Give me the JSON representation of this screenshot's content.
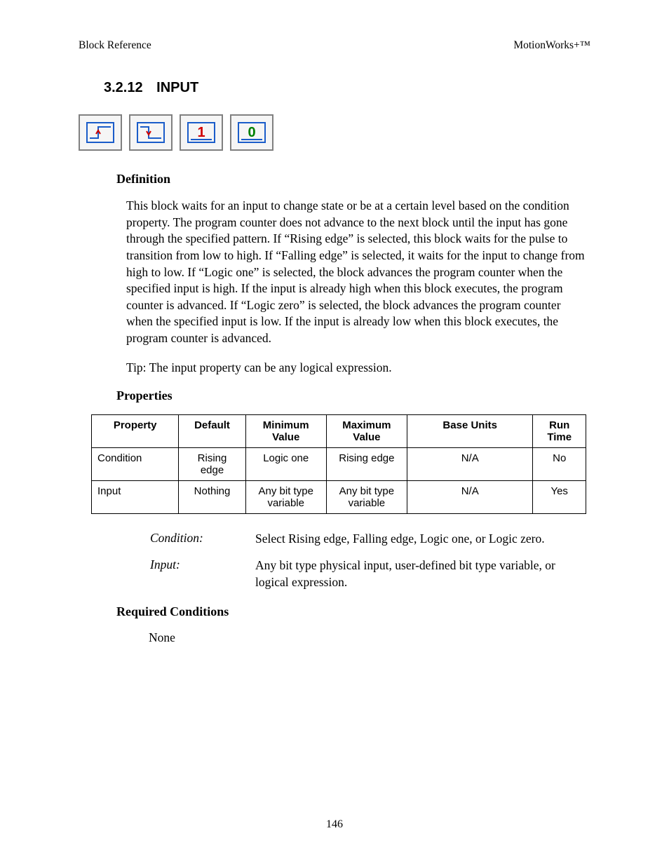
{
  "header": {
    "left": "Block Reference",
    "right": "MotionWorks+™"
  },
  "section": {
    "number": "3.2.12",
    "title": "INPUT"
  },
  "icons": [
    "rising-edge",
    "falling-edge",
    "logic-one",
    "logic-zero"
  ],
  "definition": {
    "heading": "Definition",
    "para": "This block waits for an input to change state or be at a certain level based on the condition property. The program counter does not advance to the next block until the input has gone through the specified pattern. If “Rising edge” is selected, this block waits for the pulse to transition from low to high. If “Falling edge” is selected, it waits for the input to change from high to low. If “Logic one” is selected, the block advances the program counter when the specified input is high. If the input is already high when this block executes, the program counter is advanced. If “Logic zero” is selected, the block advances the program counter when the specified input is low. If the input is already low when this block executes, the program counter is advanced.",
    "tip": "Tip:  The input property can be any logical expression."
  },
  "properties": {
    "heading": "Properties",
    "cols": [
      "Property",
      "Default",
      "Minimum Value",
      "Maximum Value",
      "Base Units",
      "Run Time"
    ],
    "rows": [
      [
        "Condition",
        "Rising edge",
        "Logic one",
        "Rising edge",
        "N/A",
        "No"
      ],
      [
        "Input",
        "Nothing",
        "Any bit type variable",
        "Any bit type variable",
        "N/A",
        "Yes"
      ]
    ],
    "defs": [
      {
        "term": "Condition:",
        "desc": "Select Rising edge, Falling edge, Logic one, or Logic zero."
      },
      {
        "term": "Input:",
        "desc": "Any bit type physical input, user-defined bit type variable, or logical expression."
      }
    ]
  },
  "required_conditions": {
    "heading": "Required Conditions",
    "text": "None"
  },
  "page_number": "146"
}
